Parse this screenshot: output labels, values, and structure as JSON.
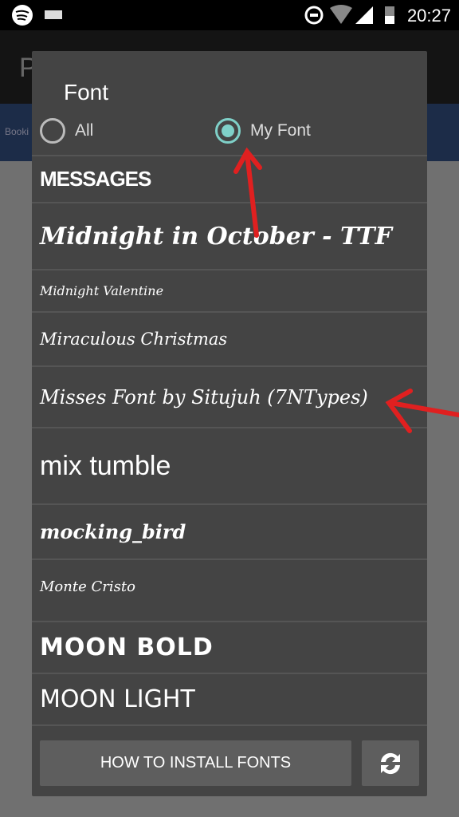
{
  "status_bar": {
    "time": "20:27",
    "icons": [
      "spotify-icon",
      "keyboard-icon",
      "do-not-disturb-icon",
      "wifi-icon",
      "signal-icon",
      "battery-icon"
    ]
  },
  "background_app": {
    "title_initial": "P",
    "ad_text": "Booki"
  },
  "dialog": {
    "title": "Font",
    "radio_options": [
      {
        "label": "All",
        "selected": false
      },
      {
        "label": "My Font",
        "selected": true
      }
    ],
    "fonts": [
      "MESSAGES",
      "Midnight in October - TTF",
      "Midnight Valentine",
      "Miraculous Christmas",
      "Misses Font by Situjuh (7NTypes)",
      "mix tumble",
      "mocking_bird",
      "Monte Cristo",
      "MOON BOLD",
      "MOON LIGHT"
    ],
    "install_button": "HOW TO INSTALL FONTS",
    "refresh_icon": "refresh-icon",
    "accent_color": "#7fd0c8"
  },
  "annotations": {
    "arrow_color": "#e02020"
  }
}
